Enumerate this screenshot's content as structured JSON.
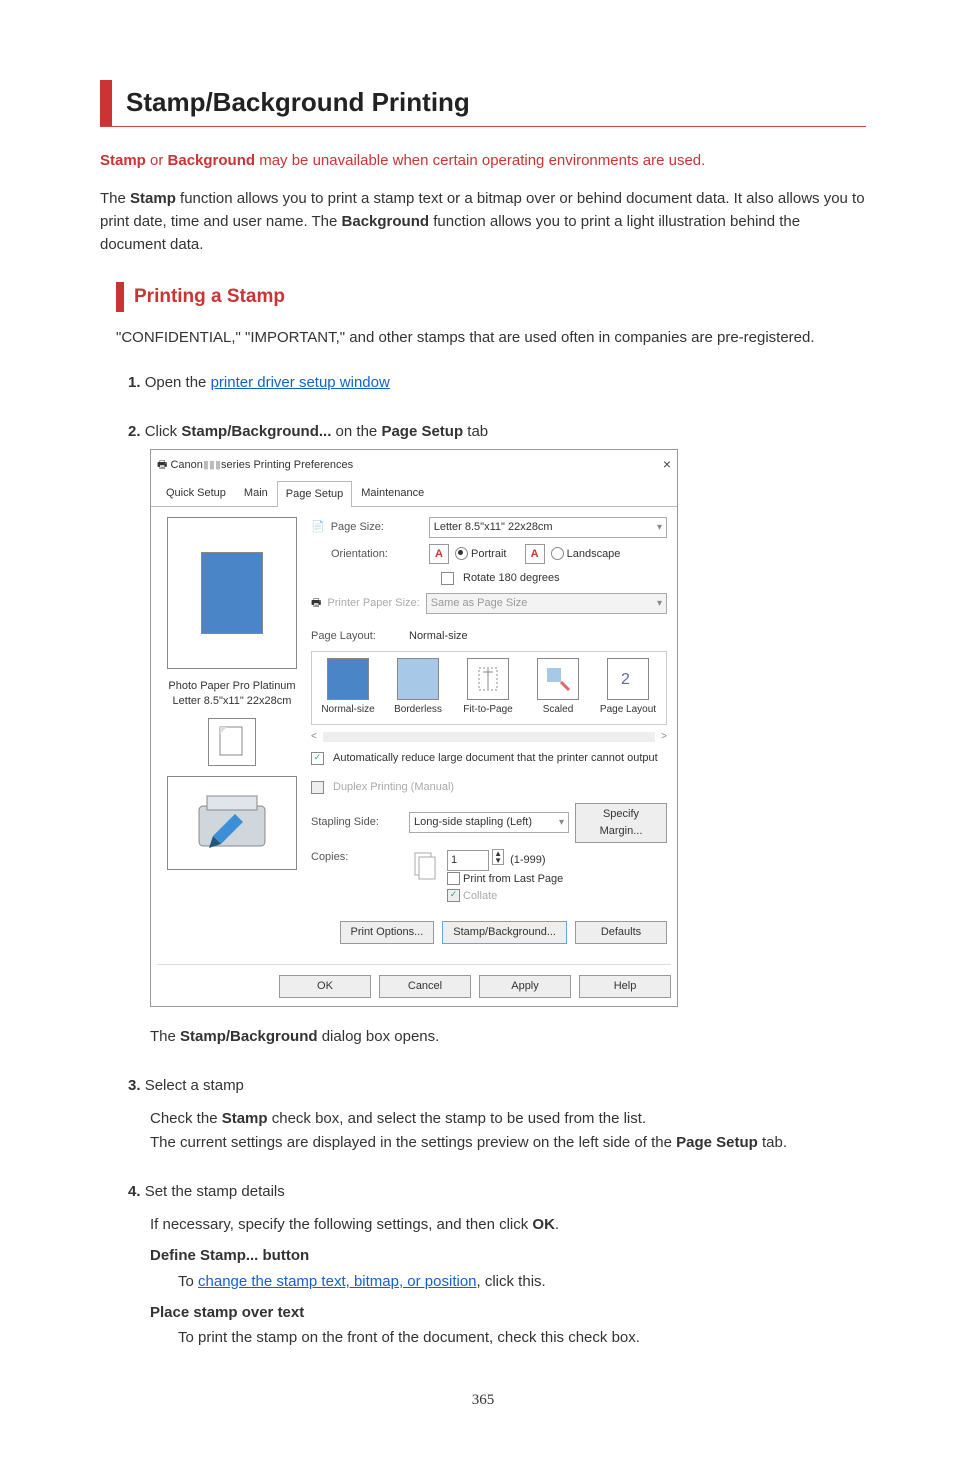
{
  "h1": "Stamp/Background Printing",
  "note_prefix": "Stamp",
  "note_or": " or ",
  "note_bg": "Background",
  "note_rest": " may be unavailable when certain operating environments are used.",
  "intro_1a": "The ",
  "intro_1b": "Stamp",
  "intro_1c": " function allows you to print a stamp text or a bitmap over or behind document data. It also allows you to print date, time and user name. The ",
  "intro_1d": "Background",
  "intro_1e": " function allows you to print a light illustration behind the document data.",
  "h2": "Printing a Stamp",
  "subpara": "\"CONFIDENTIAL,\" \"IMPORTANT,\" and other stamps that are used often in companies are pre-registered.",
  "steps": {
    "s1_num": "1.",
    "s1_a": "Open the ",
    "s1_link": "printer driver setup window",
    "s2_num": "2.",
    "s2_a": "Click ",
    "s2_b": "Stamp/Background...",
    "s2_c": " on the ",
    "s2_d": "Page Setup",
    "s2_e": " tab",
    "s2_result_a": "The ",
    "s2_result_b": "Stamp/Background",
    "s2_result_c": " dialog box opens.",
    "s3_num": "3.",
    "s3_head": "Select a stamp",
    "s3_body_a": "Check the ",
    "s3_body_b": "Stamp",
    "s3_body_c": " check box, and select the stamp to be used from the list.",
    "s3_body2_a": "The current settings are displayed in the settings preview on the left side of the ",
    "s3_body2_b": "Page Setup",
    "s3_body2_c": " tab.",
    "s4_num": "4.",
    "s4_head": "Set the stamp details",
    "s4_body_a": "If necessary, specify the following settings, and then click ",
    "s4_body_b": "OK",
    "s4_body_c": ".",
    "defstamp_t": "Define Stamp... button",
    "defstamp_a": "To ",
    "defstamp_link": "change the stamp text, bitmap, or position",
    "defstamp_b": ", click this.",
    "place_t": "Place stamp over text",
    "place_a": "To print the stamp on the front of the document, check this check box."
  },
  "dlg": {
    "title_a": "Canon",
    "title_b": " series Printing Preferences",
    "close": "×",
    "tabs": [
      "Quick Setup",
      "Main",
      "Page Setup",
      "Maintenance"
    ],
    "active_tab": 2,
    "left_label1": "Photo Paper Pro Platinum",
    "left_label2": "Letter 8.5\"x11\" 22x28cm",
    "page_size_lbl": "Page Size:",
    "page_size_val": "Letter 8.5\"x11\" 22x28cm",
    "orient_lbl": "Orientation:",
    "orient_a": "A",
    "orient_portrait": "Portrait",
    "orient_landscape": "Landscape",
    "rotate": "Rotate 180 degrees",
    "ppsize_lbl": "Printer Paper Size:",
    "ppsize_val": "Same as Page Size",
    "layout_lbl": "Page Layout:",
    "layout_val": "Normal-size",
    "layouts": [
      "Normal-size",
      "Borderless",
      "Fit-to-Page",
      "Scaled",
      "Page Layout"
    ],
    "autoreduce": "Automatically reduce large document that the printer cannot output",
    "duplex": "Duplex Printing (Manual)",
    "stapling_lbl": "Stapling Side:",
    "stapling_val": "Long-side stapling (Left)",
    "specify_margin": "Specify Margin...",
    "copies_lbl": "Copies:",
    "copies_val": "1",
    "copies_range": "(1-999)",
    "print_last": "Print from Last Page",
    "collate": "Collate",
    "foot_btns": [
      "Print Options...",
      "Stamp/Background...",
      "Defaults"
    ],
    "bottom_btns": [
      "OK",
      "Cancel",
      "Apply",
      "Help"
    ]
  },
  "pagenum": "365"
}
